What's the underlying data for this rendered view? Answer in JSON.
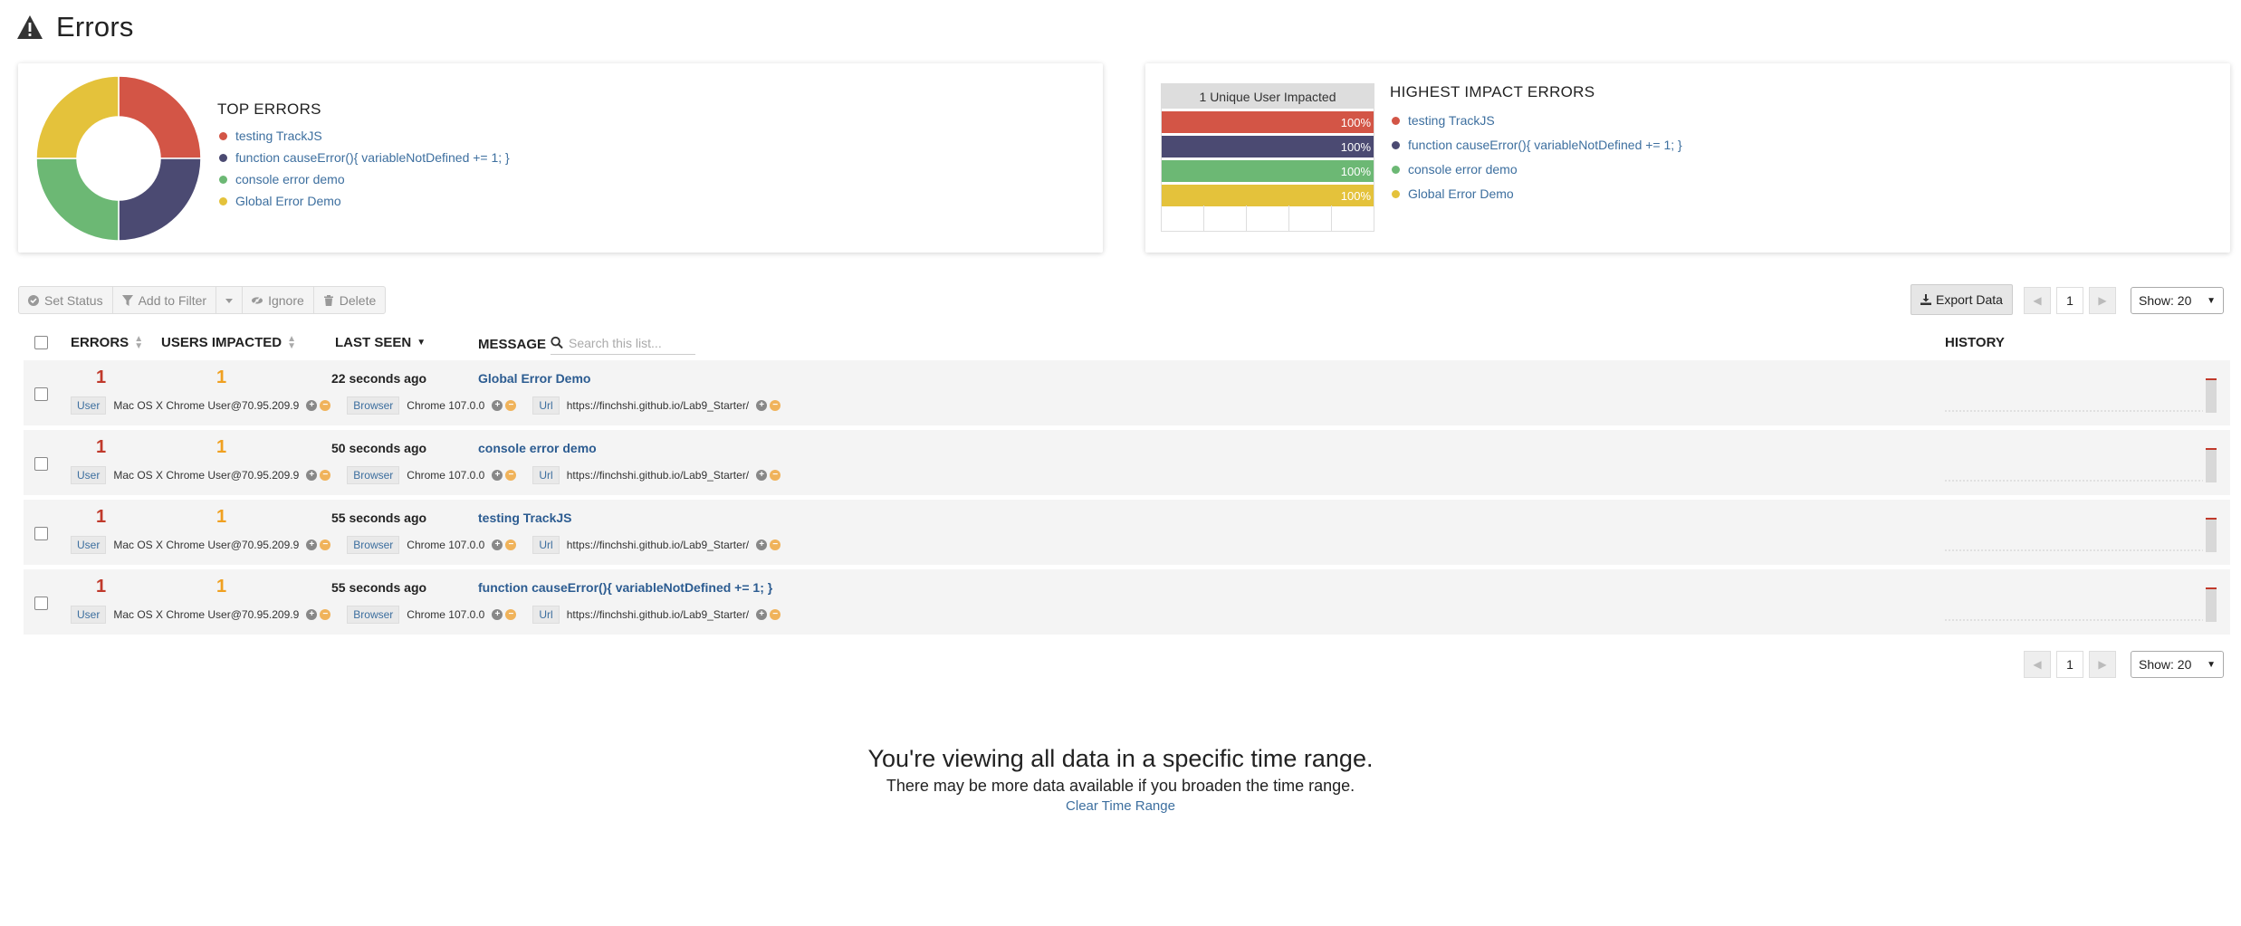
{
  "page": {
    "title": "Errors"
  },
  "colors": {
    "red": "#d35546",
    "navy": "#4b4a72",
    "green": "#6cb874",
    "yellow": "#e4c23b"
  },
  "top_errors": {
    "heading": "TOP ERRORS",
    "items": [
      {
        "label": "testing TrackJS",
        "color": "#d35546",
        "share": 0.25
      },
      {
        "label": "function causeError(){ variableNotDefined += 1; }",
        "color": "#4b4a72",
        "share": 0.25
      },
      {
        "label": "console error demo",
        "color": "#6cb874",
        "share": 0.25
      },
      {
        "label": "Global Error Demo",
        "color": "#e4c23b",
        "share": 0.25
      }
    ]
  },
  "impact": {
    "heading": "HIGHEST IMPACT ERRORS",
    "bar_header": "1 Unique User Impacted",
    "items": [
      {
        "label": "testing TrackJS",
        "color": "#d35546",
        "pct_label": "100%"
      },
      {
        "label": "function causeError(){ variableNotDefined += 1; }",
        "color": "#4b4a72",
        "pct_label": "100%"
      },
      {
        "label": "console error demo",
        "color": "#6cb874",
        "pct_label": "100%"
      },
      {
        "label": "Global Error Demo",
        "color": "#e4c23b",
        "pct_label": "100%"
      }
    ]
  },
  "toolbar": {
    "set_status": "Set Status",
    "add_to_filter": "Add to Filter",
    "ignore": "Ignore",
    "delete": "Delete",
    "export": "Export Data",
    "page": "1",
    "show": "Show: 20"
  },
  "table": {
    "headers": {
      "errors": "ERRORS",
      "users": "USERS IMPACTED",
      "last_seen": "LAST SEEN",
      "message": "MESSAGE",
      "history": "HISTORY"
    },
    "search_placeholder": "Search this list...",
    "rows": [
      {
        "errors": "1",
        "users": "1",
        "last_seen": "22 seconds ago",
        "message": "Global Error Demo",
        "user_label": "User",
        "user": "Mac OS X Chrome User@70.95.209.9",
        "browser_label": "Browser",
        "browser": "Chrome 107.0.0",
        "url_label": "Url",
        "url": "https://finchshi.github.io/Lab9_Starter/"
      },
      {
        "errors": "1",
        "users": "1",
        "last_seen": "50 seconds ago",
        "message": "console error demo",
        "user_label": "User",
        "user": "Mac OS X Chrome User@70.95.209.9",
        "browser_label": "Browser",
        "browser": "Chrome 107.0.0",
        "url_label": "Url",
        "url": "https://finchshi.github.io/Lab9_Starter/"
      },
      {
        "errors": "1",
        "users": "1",
        "last_seen": "55 seconds ago",
        "message": "testing TrackJS",
        "user_label": "User",
        "user": "Mac OS X Chrome User@70.95.209.9",
        "browser_label": "Browser",
        "browser": "Chrome 107.0.0",
        "url_label": "Url",
        "url": "https://finchshi.github.io/Lab9_Starter/"
      },
      {
        "errors": "1",
        "users": "1",
        "last_seen": "55 seconds ago",
        "message": "function causeError(){ variableNotDefined += 1; }",
        "user_label": "User",
        "user": "Mac OS X Chrome User@70.95.209.9",
        "browser_label": "Browser",
        "browser": "Chrome 107.0.0",
        "url_label": "Url",
        "url": "https://finchshi.github.io/Lab9_Starter/"
      }
    ]
  },
  "bottom_pager": {
    "page": "1",
    "show": "Show: 20"
  },
  "empty_state": {
    "title": "You're viewing all data in a specific time range.",
    "subtitle": "There may be more data available if you broaden the time range.",
    "link": "Clear Time Range"
  }
}
